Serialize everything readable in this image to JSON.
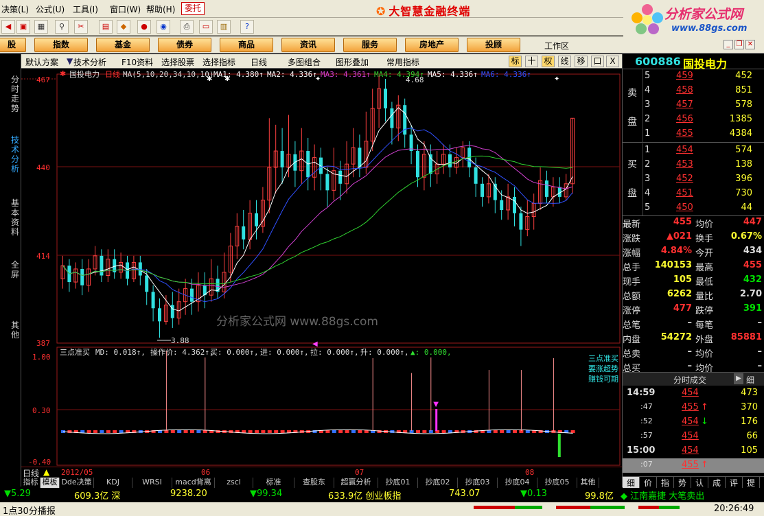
{
  "menu": {
    "items": [
      "决策(L)",
      "公式(U)",
      "工具(I)",
      "窗口(W)",
      "帮助(H)"
    ],
    "weituo": "委托",
    "app_title": "大智慧金融终端"
  },
  "logo": {
    "title": "分析家公式网",
    "url": "www.88gs.com"
  },
  "categories": [
    "股",
    "指数",
    "基金",
    "债券",
    "商品",
    "资讯",
    "服务",
    "房地产",
    "投顾"
  ],
  "workarea": "工作区",
  "left_tabs": [
    {
      "label": "分时走势",
      "active": false
    },
    {
      "label": "技术分析",
      "active": true
    },
    {
      "label": "基本资料",
      "active": false
    },
    {
      "label": "全屏",
      "active": false
    },
    {
      "label": "其他",
      "active": false
    }
  ],
  "chart_toolbar": {
    "items": [
      "默认方案",
      "技术分析",
      "F10资料",
      "选择股票",
      "选择指标",
      "日线",
      "多图组合",
      "图形叠加",
      "常用指标"
    ],
    "buttons": [
      "标",
      "十",
      "权",
      "线",
      "移",
      "口",
      "X"
    ]
  },
  "chart": {
    "title": "国投电力",
    "period": "日线",
    "ma_params": "MA(5,10,20,34,10,10)",
    "ma": [
      {
        "label": "MA1:",
        "value": "4.380",
        "color": "#ffffff"
      },
      {
        "label": "MA2:",
        "value": "4.336",
        "color": "#ffffff"
      },
      {
        "label": "MA3:",
        "value": "4.361",
        "color": "#d040d0"
      },
      {
        "label": "MA4:",
        "value": "4.394",
        "color": "#30d030"
      },
      {
        "label": "MA5:",
        "value": "4.336",
        "color": "#ffffff"
      },
      {
        "label": "MA6:",
        "value": "4.336",
        "color": "#3050ff"
      }
    ],
    "y_ticks": [
      "467",
      "440",
      "414",
      "387"
    ],
    "high_label": "4.68",
    "low_label": "3.88",
    "watermark": "分析家公式网 www.88gs.com",
    "indicator": {
      "name": "三点准买",
      "params": [
        {
          "label": "MD:",
          "value": "0.018"
        },
        {
          "label": "操作价:",
          "value": "4.362"
        },
        {
          "label": "买:",
          "value": "0.000"
        },
        {
          "label": "进:",
          "value": "0.000"
        },
        {
          "label": "拉:",
          "value": "0.000"
        },
        {
          "label": "升:",
          "value": "0.000"
        },
        {
          "label": "",
          "value": "0.000"
        }
      ],
      "y_ticks": [
        "1.00",
        "0.30",
        "-0.40"
      ],
      "legend": [
        "三点准买",
        "要涨超势",
        "赚钱可期"
      ]
    },
    "months": [
      "2012/05",
      "06",
      "07",
      "08"
    ],
    "period_label": "日线"
  },
  "bottom_tabs": [
    "指标",
    "模板",
    "Dde决策",
    "KDJ",
    "WRSI",
    "macd背离",
    "zscl",
    "标准",
    "查股东",
    "超赢分析",
    "抄底01",
    "抄底02",
    "抄底03",
    "抄底04",
    "抄底05",
    "其他"
  ],
  "stock": {
    "code": "600886",
    "name": "国投电力",
    "sell_label": [
      "卖",
      "盘"
    ],
    "buy_label": [
      "买",
      "盘"
    ],
    "sell": [
      {
        "lv": "5",
        "price": "459",
        "vol": "452"
      },
      {
        "lv": "4",
        "price": "458",
        "vol": "851"
      },
      {
        "lv": "3",
        "price": "457",
        "vol": "578"
      },
      {
        "lv": "2",
        "price": "456",
        "vol": "1385"
      },
      {
        "lv": "1",
        "price": "455",
        "vol": "4384"
      }
    ],
    "buy": [
      {
        "lv": "1",
        "price": "454",
        "vol": "574"
      },
      {
        "lv": "2",
        "price": "453",
        "vol": "138"
      },
      {
        "lv": "3",
        "price": "452",
        "vol": "396"
      },
      {
        "lv": "4",
        "price": "451",
        "vol": "730"
      },
      {
        "lv": "5",
        "price": "450",
        "vol": "44"
      }
    ],
    "stats": [
      {
        "k1": "最新",
        "v1": "455",
        "k2": "均价",
        "v2": "447"
      },
      {
        "k1": "涨跌",
        "v1": "▲021",
        "k2": "换手",
        "v2": "0.67%"
      },
      {
        "k1": "涨幅",
        "v1": "4.84%",
        "k2": "今开",
        "v2": "434"
      },
      {
        "k1": "总手",
        "v1": "140153",
        "k2": "最高",
        "v2": "455"
      },
      {
        "k1": "现手",
        "v1": "105",
        "k2": "最低",
        "v2": "432"
      },
      {
        "k1": "总额",
        "v1": "6262",
        "k2": "量比",
        "v2": "2.70"
      },
      {
        "k1": "涨停",
        "v1": "477",
        "k2": "跌停",
        "v2": "391"
      },
      {
        "k1": "总笔",
        "v1": "–",
        "k2": "每笔",
        "v2": "–"
      },
      {
        "k1": "内盘",
        "v1": "54272",
        "k2": "外盘",
        "v2": "85881"
      },
      {
        "k1": "总卖",
        "v1": "–",
        "k2": "均价",
        "v2": "–"
      },
      {
        "k1": "总买",
        "v1": "–",
        "k2": "均价",
        "v2": "–"
      }
    ],
    "trade_header": "分时成交",
    "trade_tab": "细",
    "trades": [
      {
        "t": "14:59",
        "p": "454",
        "v": "473",
        "arrow": ""
      },
      {
        "t": ":47",
        "p": "455",
        "v": "370",
        "arrow": "up"
      },
      {
        "t": ":52",
        "p": "454",
        "v": "176",
        "arrow": "down"
      },
      {
        "t": ":57",
        "p": "454",
        "v": "66",
        "arrow": ""
      },
      {
        "t": "15:00",
        "p": "454",
        "v": "105",
        "arrow": ""
      },
      {
        "t": ":07",
        "p": "455",
        "v": "",
        "arrow": "up"
      }
    ],
    "bottom_tabs": [
      "细",
      "价",
      "指",
      "势",
      "认",
      "成",
      "评",
      "提"
    ]
  },
  "statusbar": {
    "items": [
      {
        "text": "▼5.29",
        "c": "grn"
      },
      {
        "text": "609.3亿 深",
        "c": "yel"
      },
      {
        "text": "9238.20",
        "c": "yel"
      },
      {
        "text": "▼99.34",
        "c": "grn"
      },
      {
        "text": "633.9亿 创业板指",
        "c": "yel"
      },
      {
        "text": "743.07",
        "c": "yel"
      },
      {
        "text": "▼0.13",
        "c": "grn"
      },
      {
        "text": "99.8亿",
        "c": "yel"
      },
      {
        "text": "◆ 江南嘉捷 大笔卖出",
        "c": "grn"
      }
    ],
    "bottom_left": "1点30分播报",
    "time": "20:26:49"
  }
}
